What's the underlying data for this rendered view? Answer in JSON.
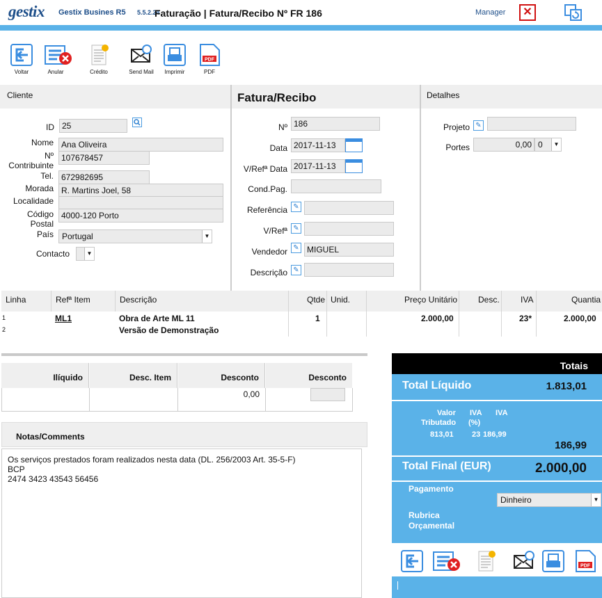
{
  "header": {
    "logo": "gestix",
    "app_name": "Gestix Busines R5",
    "app_version": "5.5.2.24",
    "title": "Faturação | Fatura/Recibo Nº FR 186",
    "user": "Manager",
    "close_icon": "close-icon",
    "sync_icon": "sync-icon"
  },
  "toolbar": {
    "voltar": "Voltar",
    "anular": "Anular",
    "credito": "Crédito",
    "send_mail": "Send Mail",
    "imprimir": "Imprimir",
    "pdf": "PDF"
  },
  "cliente": {
    "header": "Cliente",
    "id_label": "ID",
    "id_value": "25",
    "nome_label": "Nome",
    "nome_value": "Ana Oliveira",
    "contribuinte_label_1": "Nº",
    "contribuinte_label_2": "Contribuinte",
    "contribuinte_value": "107678457",
    "tel_label": "Tel.",
    "tel_value": "672982695",
    "morada_label": "Morada",
    "morada_value": "R. Martins Joel, 58",
    "localidade_label": "Localidade",
    "localidade_value": "",
    "codigo_label_1": "Código",
    "codigo_label_2": "Postal",
    "codigo_value": "4000-120 Porto",
    "pais_label": "País",
    "pais_value": "Portugal",
    "contacto_label": "Contacto",
    "contacto_value": ""
  },
  "documento": {
    "header": "Fatura/Recibo",
    "numero_label": "Nº",
    "numero_value": "186",
    "data_label": "Data",
    "data_value": "2017-11-13",
    "vref_data_label": "V/Refª Data",
    "vref_data_value": "2017-11-13",
    "cond_pag_label": "Cond.Pag.",
    "cond_pag_value": "",
    "referencia_label": "Referência",
    "referencia_value": "",
    "vref_label": "V/Refª",
    "vref_value": "",
    "vendedor_label": "Vendedor",
    "vendedor_value": "MIGUEL",
    "descricao_label": "Descrição",
    "descricao_value": ""
  },
  "detalhes": {
    "header": "Detalhes",
    "projeto_label": "Projeto",
    "projeto_value": "",
    "portes_label": "Portes",
    "portes_value": "0,00",
    "portes_select": "0"
  },
  "lines": {
    "headers": {
      "linha": "Linha",
      "ref_item": "Refª Item",
      "descricao": "Descrição",
      "qtde": "Qtde",
      "unid": "Unid.",
      "preco": "Preço Unitário",
      "desc": "Desc.",
      "iva": "IVA",
      "quantia": "Quantia"
    },
    "rows": [
      {
        "linha": "1",
        "ref": "ML1",
        "descricao": "Obra de Arte ML 11",
        "qtde": "1",
        "unid": "",
        "preco": "2.000,00",
        "desc": "",
        "iva": "23*",
        "quantia": "2.000,00"
      },
      {
        "linha": "2",
        "ref": "",
        "descricao": "Versão de Demonstração",
        "qtde": "",
        "unid": "",
        "preco": "",
        "desc": "",
        "iva": "",
        "quantia": ""
      }
    ]
  },
  "discounts": {
    "headers": [
      "Ilíquido",
      "Desc. Item",
      "Desconto",
      "Desconto"
    ],
    "values": [
      "",
      "",
      "0,00",
      ""
    ]
  },
  "notas": {
    "header": "Notas/Comments",
    "line1": "Os serviços prestados foram realizados nesta data (DL. 256/2003 Art. 35-5-F)",
    "line2": "BCP",
    "line3": "2474 3423 43543 56456"
  },
  "totais": {
    "header": "Totais",
    "total_liquido_label": "Total Líquido",
    "total_liquido_value": "1.813,01",
    "valor_tributado_label_1": "Valor",
    "valor_tributado_label_2": "Tributado",
    "iva_pct_label_1": "IVA",
    "iva_pct_label_2": "(%)",
    "iva_label": "IVA",
    "valor_tributado_value": "813,01",
    "iva_pct_value": "23",
    "iva_value": "186,99",
    "iva_total": "186,99",
    "total_final_label": "Total Final (EUR)",
    "total_final_value": "2.000,00",
    "pagamento_label": "Pagamento",
    "pagamento_value": "Dinheiro",
    "rubrica_label_1": "Rubrica",
    "rubrica_label_2": "Orçamental"
  },
  "colors": {
    "brand_blue": "#1e4f8a",
    "accent_blue": "#5ab2e8",
    "panel_grey": "#efefef"
  }
}
